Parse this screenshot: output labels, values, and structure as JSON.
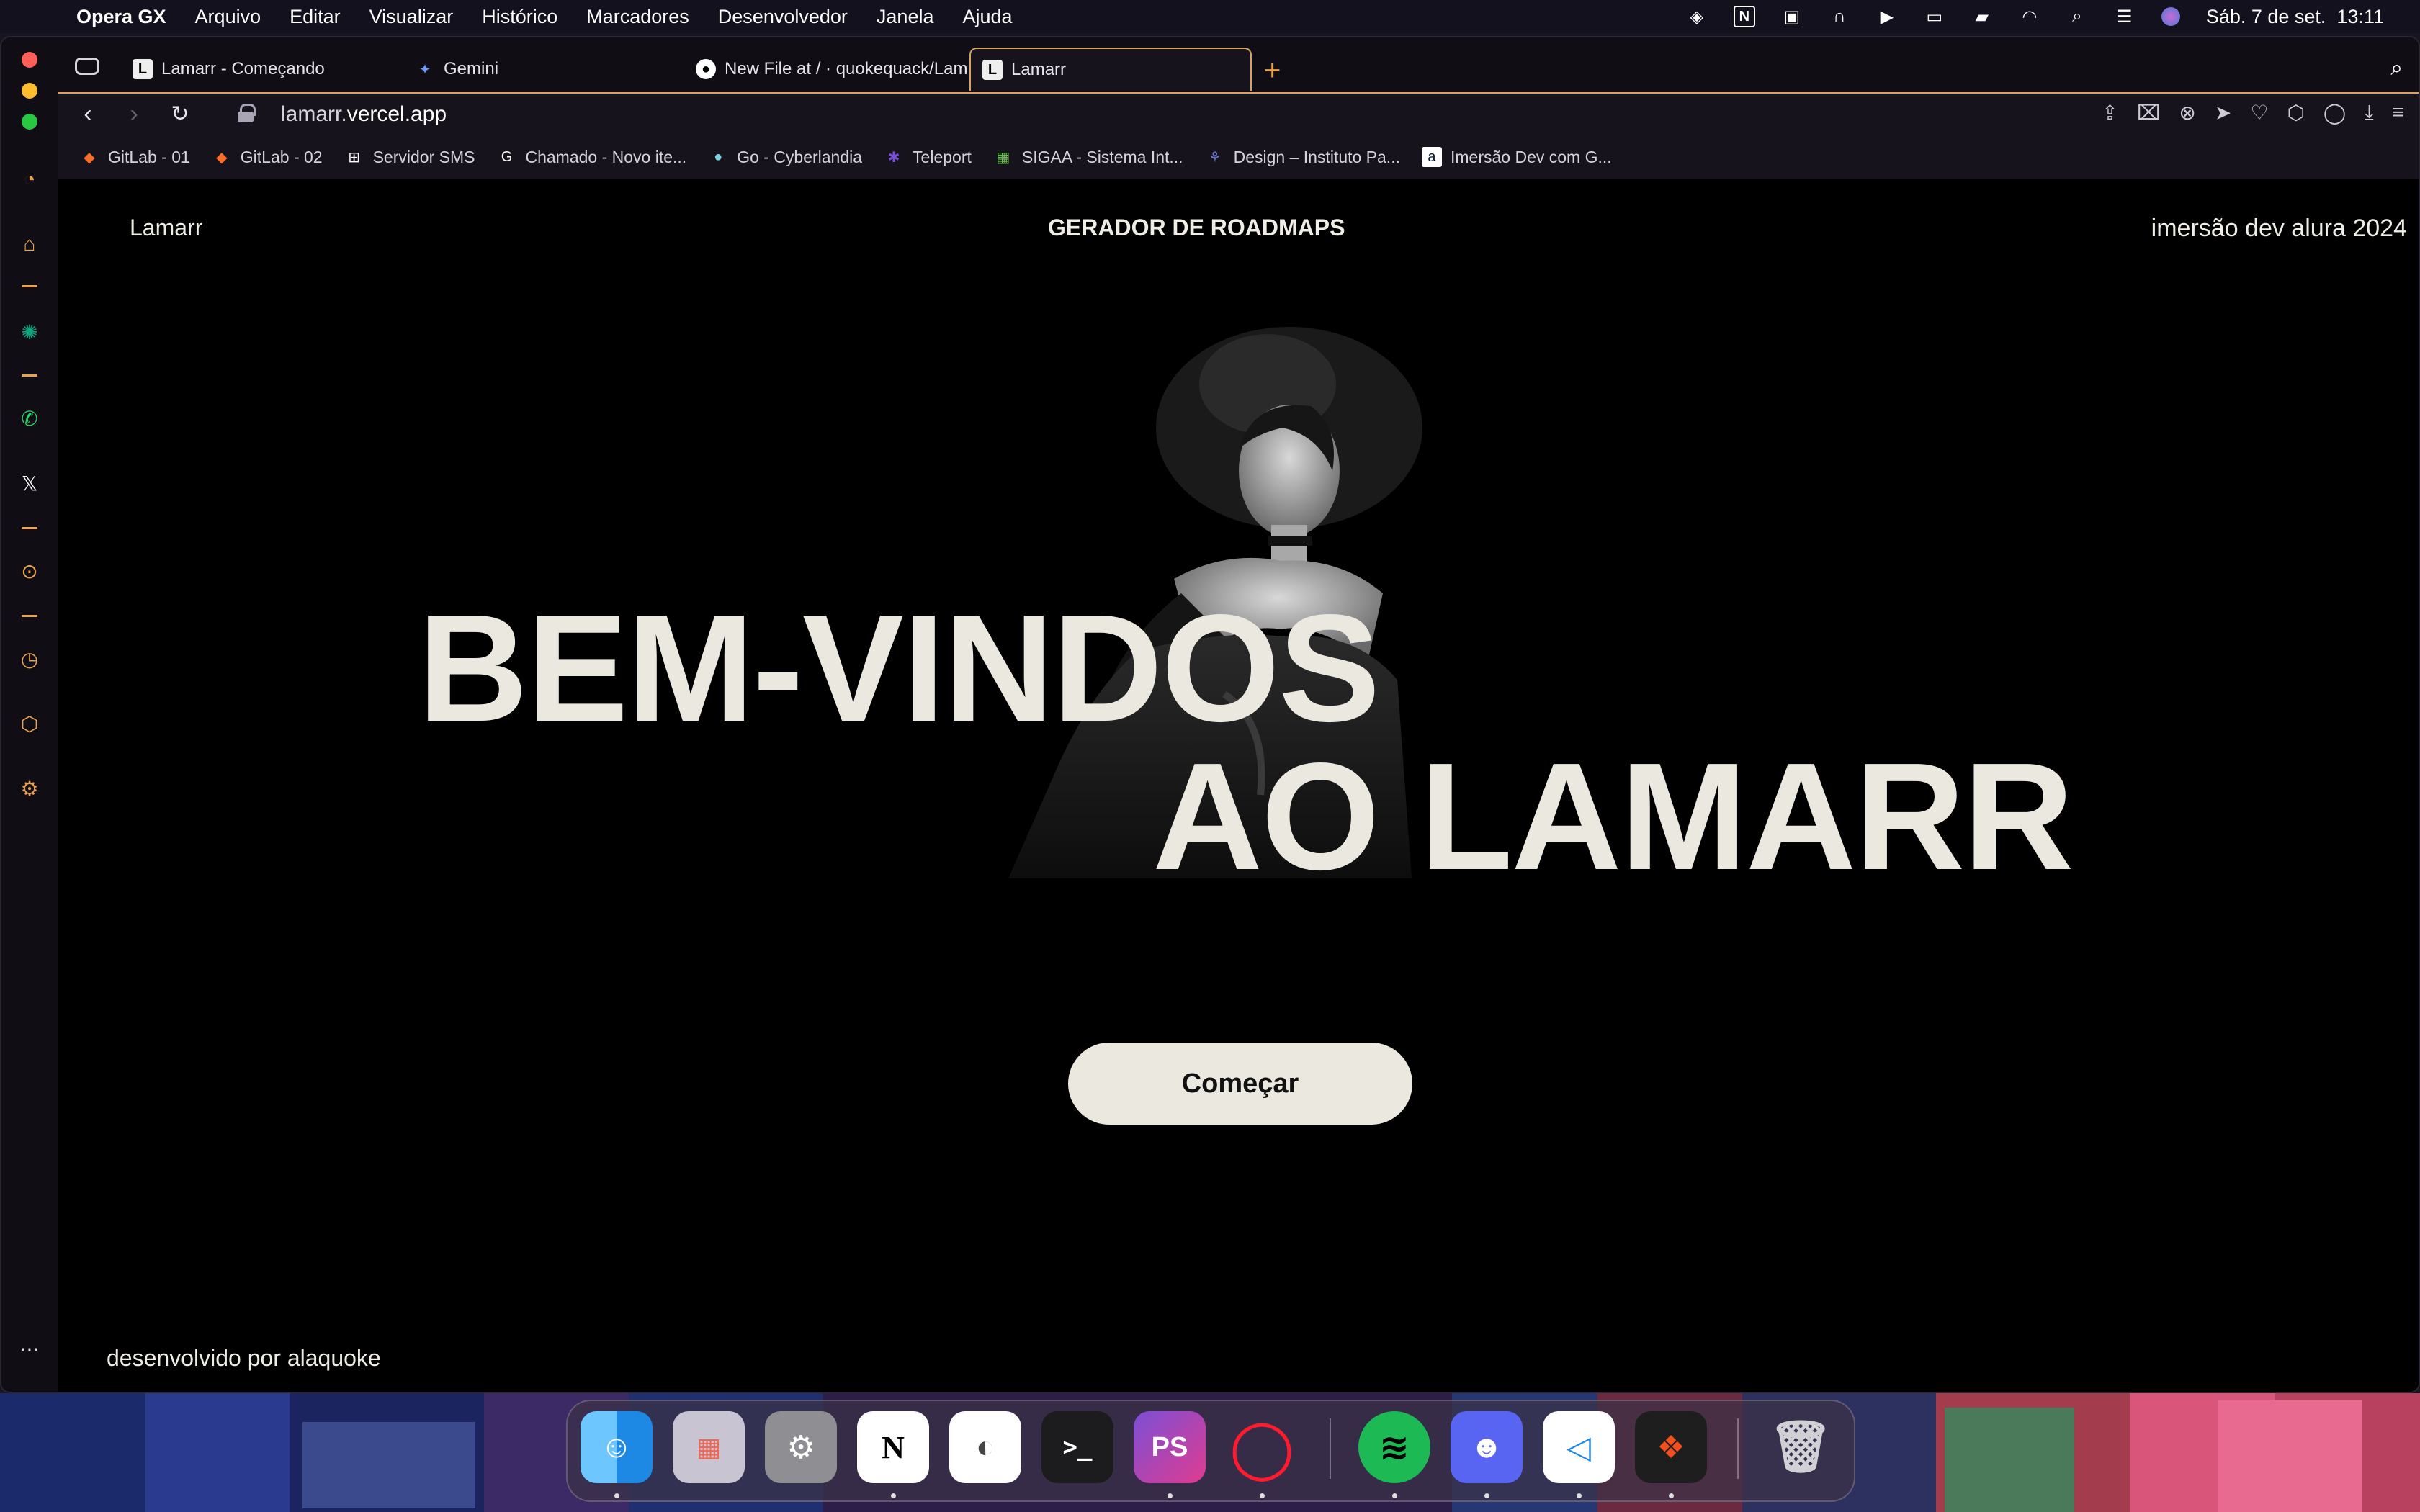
{
  "menubar": {
    "app_name": "Opera GX",
    "items": [
      "Arquivo",
      "Editar",
      "Visualizar",
      "Histórico",
      "Marcadores",
      "Desenvolvedor",
      "Janela",
      "Ajuda"
    ],
    "datetime": "Sáb. 7 de set.  13:11"
  },
  "tabs": [
    {
      "label": "Lamarr - Começando",
      "icon": "L"
    },
    {
      "label": "Gemini",
      "icon": "✦"
    },
    {
      "label": "New File at / · quokequack/Lam",
      "icon": "github"
    },
    {
      "label": "Lamarr",
      "icon": "L"
    }
  ],
  "address": {
    "host_prefix": "lamarr.",
    "host_rest": "vercel.app"
  },
  "bookmarks": [
    {
      "label": "GitLab - 01",
      "icon": "gitlab-icon"
    },
    {
      "label": "GitLab - 02",
      "icon": "gitlab-icon"
    },
    {
      "label": "Servidor SMS",
      "icon": "sms-icon"
    },
    {
      "label": "Chamado - Novo ite...",
      "icon": "glpi-icon"
    },
    {
      "label": "Go - Cyberlandia",
      "icon": "go-icon"
    },
    {
      "label": "Teleport",
      "icon": "teleport-icon"
    },
    {
      "label": "SIGAA - Sistema Int...",
      "icon": "sigaa-icon"
    },
    {
      "label": "Design – Instituto Pa...",
      "icon": "butterfly-icon"
    },
    {
      "label": "Imersão Dev com G...",
      "icon": "alura-icon"
    }
  ],
  "page": {
    "brand": "Lamarr",
    "title": "GERADOR DE ROADMAPS",
    "event": "imersão dev alura 2024",
    "headline_line1": "BEM-VINDOS",
    "headline_line2": "AO LAMARR",
    "cta": "Começar",
    "credit": "desenvolvido por alaquoke"
  },
  "dock": {
    "apps": [
      "Finder",
      "Launchpad",
      "System Settings",
      "Notion",
      "Sequel Ace",
      "Terminal",
      "PhpStorm",
      "Opera",
      "Spotify",
      "Discord",
      "VS Code",
      "Figma",
      "Trash"
    ]
  },
  "colors": {
    "accent": "#e9a24b",
    "page_bg": "#000000",
    "text_light": "#ebe8df"
  }
}
